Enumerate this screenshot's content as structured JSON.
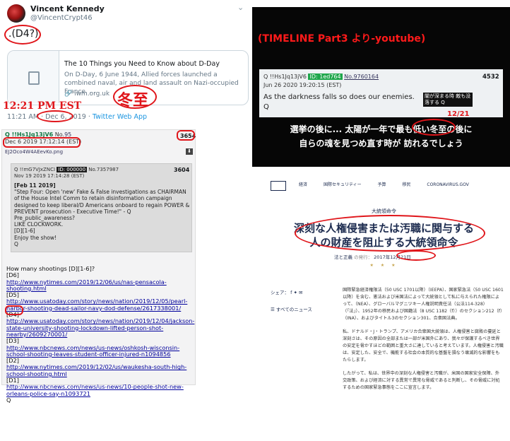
{
  "tweet": {
    "display_name": "Vincent Kennedy",
    "handle": "@VincentCrypt46",
    "chevron": "⌄",
    "text": ".(D4?)",
    "card": {
      "title": "The 10 Things you Need to Know about D-Day",
      "description": "On D-Day, 6 June 1944, Allied forces launched a combined naval, air and land assault on Nazi-occupied France. ...",
      "url": "🔗 iwm.org.uk"
    },
    "time": "11:21 AM",
    "date": "Dec 6, 2019",
    "source": "Twitter Web App",
    "handwritten_time": "12:21 PM EST",
    "handwritten_kanji": "冬至"
  },
  "qpost": {
    "header_name": "Q !!Hs1Jq13jV6",
    "header_no_label": "No.",
    "header_no": "95",
    "date": "Dec 6 2019 17:12:14 (EST)",
    "number": "3654",
    "file": "EJ2Oco4W4AEevKo.png",
    "download": "⬇",
    "inner": {
      "name": "Q !!mG7VJxZNCI",
      "id": "ID: 000000",
      "no": "No.7357987",
      "date": "Nov 19 2019 17:14:28 (EST)",
      "number": "3604",
      "lines": [
        "[Feb 11 2019]",
        "\"Step Four: Open 'new' Fake & False investigations as CHAIRMAN of the House Intel Comm to retain disinformation campaign designed to keep liberal/D Americans onboard to regain POWER & PREVENT prosecution - Executive Time!\" - Q",
        "Pre_public_awareness?",
        "LIKE CLOCKWORK.",
        "[D][1-6]",
        "Enjoy the show!",
        "Q"
      ]
    },
    "question": "How many shootings [D][1-6]?",
    "entries": [
      {
        "label": "[D6]",
        "link": "http://www.nytimes.com/2019/12/06/us/nas-pensacola-shooting.html"
      },
      {
        "label": "[D5]",
        "link": "http://www.usatoday.com/story/news/nation/2019/12/05/pearl-harbor-shooting-dead-sailor-navy-dod-defense/2617338001/"
      },
      {
        "label": "[D4]",
        "link": "http://www.usatoday.com/story/news/nation/2019/12/04/jackson-state-university-shooting-lockdown-lifted-person-shot-nearby/2609270001/"
      },
      {
        "label": "[D3]",
        "link": "http://www.nbcnews.com/news/us-news/oshkosh-wisconsin-school-shooting-leaves-student-officer-injured-n1094856"
      },
      {
        "label": "[D2]",
        "link": "http://www.nytimes.com/2019/12/02/us/waukesha-south-high-school-shooting.html"
      },
      {
        "label": "[D1]",
        "link": "http://www.nbcnews.com/news/us-news/10-people-shot-new-orleans-police-say-n1093721"
      }
    ],
    "signature": "Q"
  },
  "video": {
    "title": "(TIMELINE Part3 より-youtube)",
    "post": {
      "name": "Q !!Hs1Jq13jV6",
      "id": "ID: 1ed764",
      "no": "No.9760164",
      "date": "Jun 26 2020 19:20:15 (EST)",
      "number": "4532",
      "text": "As the darkness falls so does our enemies.",
      "sig": "Q",
      "overlay": "闇が深まる時 敵も没落する Q"
    },
    "handwritten_date": "12/21",
    "subtitle_1": "選挙の後に... 太陽が一年で最も低い冬至の後に",
    "subtitle_2": "自らの魂を見つめ直す時が 訪れるでしょう"
  },
  "whitehouse": {
    "nav": [
      "経済",
      "国際セキュリティー",
      "予算",
      "移民",
      "CORONAVIRUS.GOV"
    ],
    "kicker": "大統領命令",
    "title_1": "深刻な人権侵害または汚職に関与する",
    "title_2": "人の財産を阻止する大統領命令",
    "category": "法と正義",
    "issued": "の発行：",
    "date": "2017年12月21日",
    "stars": "★ ★ ★",
    "share": "シェア：",
    "news": "すべてのニュース",
    "paragraphs": [
      "国際緊急経済権限法（50 USC 1701以降）（IEEPA）、国家緊急法（50 USC 1601以降）を含む、憲法および米国法によって大統領として私に与えられた権限によって、（NEA）、グローバルマグニツキー人権説明責任法（公法114-328）（「法」）、1952年の移民および国籍法（8 USC 1182（f））のセクション212（f）（INA）、およびタイトル3のセクション301、合衆国法典。",
      "私、ドナルド・J・トランプ、アメリカ合衆国大統領は、人権侵害と腐敗の蔓延と深刻さは、その原因の全部または一部が米国外にあり、我々が保護するべき世界の安定を脅かすほどの範囲と重大さに達していると考えています。人権侵害と汚職は、安定した、安全で、機能する社会の本質的な基盤を損なう壊滅的な影響をもたらします。",
      "したがって、私は、世界中の深刻な人権侵害と汚職が、米国の国家安全保障、外交政策、および経済に対する異常で異常な脅威であると判断し、その脅威に対処するための国家緊急事態をここに宣言します。"
    ]
  }
}
